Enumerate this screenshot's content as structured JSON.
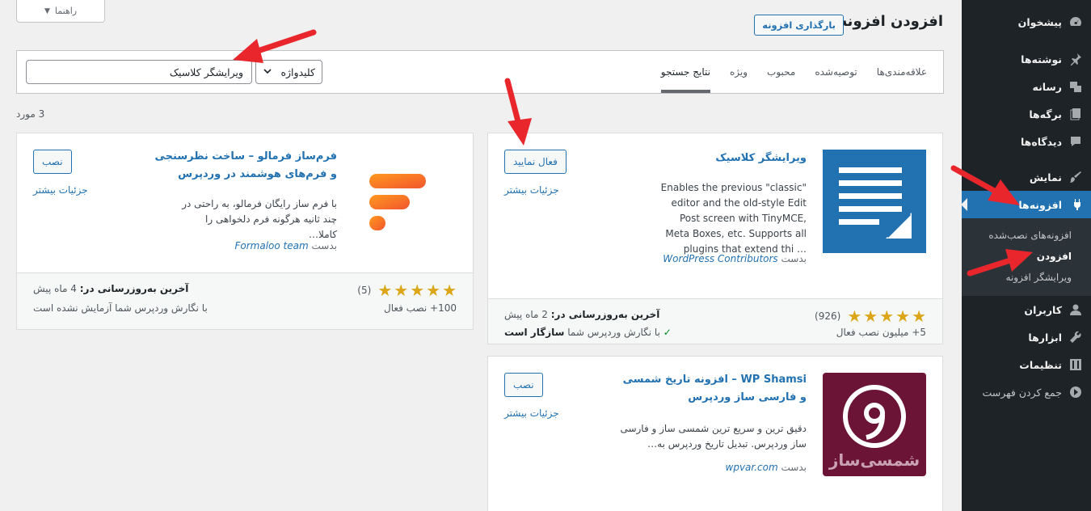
{
  "help": {
    "label": "راهنما"
  },
  "header": {
    "title": "افزودن افزونه",
    "upload_label": "بارگذاری افزونه"
  },
  "sidebar": {
    "items": [
      {
        "label": "پیشخوان",
        "icon": "dashboard-icon"
      },
      {
        "label": "نوشته‌ها",
        "icon": "pin-icon"
      },
      {
        "label": "رسانه",
        "icon": "media-icon"
      },
      {
        "label": "برگه‌ها",
        "icon": "pages-icon"
      },
      {
        "label": "دیدگاه‌ها",
        "icon": "comment-icon"
      },
      {
        "label": "نمایش",
        "icon": "appearance-icon"
      },
      {
        "label": "افزونه‌ها",
        "icon": "plugins-icon"
      },
      {
        "label": "کاربران",
        "icon": "users-icon"
      },
      {
        "label": "ابزارها",
        "icon": "tools-icon"
      },
      {
        "label": "تنظیمات",
        "icon": "settings-icon"
      },
      {
        "label": "جمع کردن فهرست",
        "icon": "collapse-icon"
      }
    ],
    "submenu": [
      {
        "label": "افزونه‌های نصب‌شده"
      },
      {
        "label": "افزودن"
      },
      {
        "label": "ویرایشگر افزونه"
      }
    ]
  },
  "filter": {
    "tabs": [
      "نتایج جستجو",
      "ویژه",
      "محبوب",
      "توصیه‌شده",
      "علاقه‌مندی‌ها"
    ],
    "select_value": "کلیدواژه",
    "search_value": "ویرایشگر کلاسیک"
  },
  "result_count": "3 مورد",
  "plugins": [
    {
      "name": "ویرایشگر کلاسیک",
      "desc": "Enables the previous \"classic\" editor and the old-style Edit Post screen with TinyMCE, Meta Boxes, etc. Supports all plugins that extend thi …",
      "by": "بدست",
      "author": "WordPress Contributors",
      "action": "فعال نمایید",
      "more": "جزئیات بیشتر",
      "rating_count": "(926)",
      "installs": "5+ میلیون نصب فعال",
      "updated_label": "آخرین به‌روزرسانی در:",
      "updated_value": "2 ماه پیش",
      "compat_prefix": "با نگارش وردپرس شما",
      "compat_status": "سازگار است"
    },
    {
      "name": "فرم‌ساز فرمالو – ساخت نظرسنجی و فرم‌های هوشمند در وردپرس",
      "desc": "با فرم ساز رایگان فرمالو، به راحتی در چند ثانیه هرگونه فرم دلخواهی را کاملا…",
      "by": "بدست",
      "author": "Formaloo team",
      "action": "نصب",
      "more": "جزئیات بیشتر",
      "rating_count": "(5)",
      "installs": "100+ نصب فعال",
      "updated_label": "آخرین به‌روزرسانی در:",
      "updated_value": "4 ماه پیش",
      "compat_text": "با نگارش وردپرس شما آزمایش نشده است"
    },
    {
      "name": "WP Shamsi – افزونه تاریخ شمسی و فارسی ساز وردپرس",
      "desc": "دقیق ترین و سریع ترین شمسی ساز و فارسی ساز وردپرس. تبدیل تاریخ وردپرس به…",
      "by": "بدست",
      "author": "wpvar.com",
      "action": "نصب",
      "more": "جزئیات بیشتر",
      "logo_text": "شمسی‌ساز"
    }
  ],
  "colors": {
    "accent": "#2271b1",
    "sidebar_bg": "#1d2327",
    "star": "#dba617",
    "arrow": "#e8262c"
  }
}
